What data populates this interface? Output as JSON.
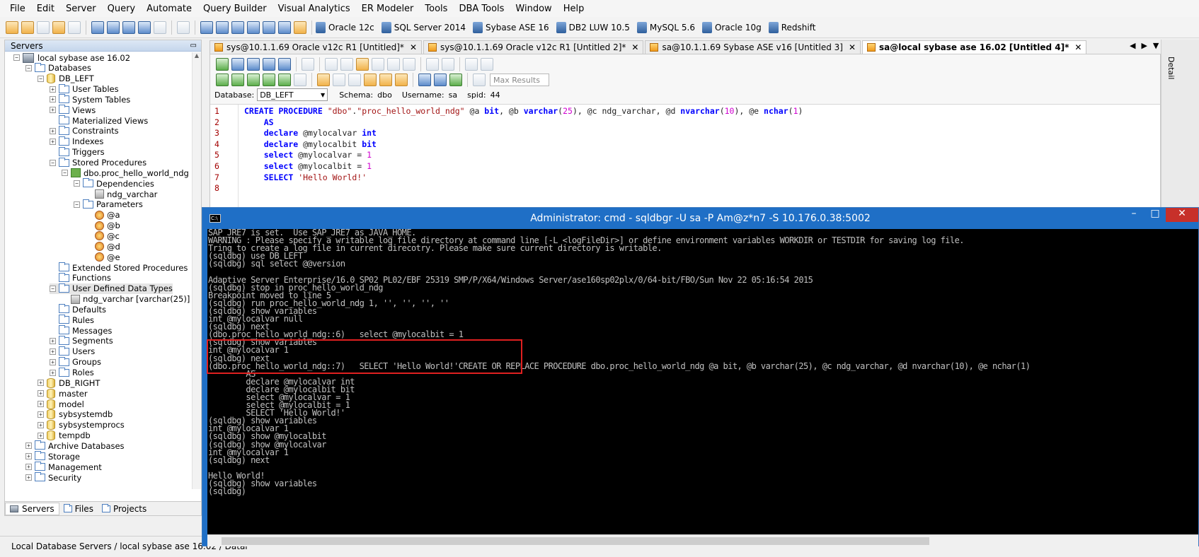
{
  "menu": [
    "File",
    "Edit",
    "Server",
    "Query",
    "Automate",
    "Query Builder",
    "Visual Analytics",
    "ER Modeler",
    "Tools",
    "DBA Tools",
    "Window",
    "Help"
  ],
  "toolbar": {
    "connections": [
      "Oracle 12c",
      "SQL Server 2014",
      "Sybase ASE 16",
      "DB2 LUW 10.5",
      "MySQL 5.6",
      "Oracle 10g",
      "Redshift"
    ]
  },
  "servers_panel": {
    "title": "Servers",
    "tree": [
      {
        "label": "local sybase ase 16.02",
        "depth": 1,
        "exp": "-",
        "icon": "server-icon"
      },
      {
        "label": "Databases",
        "depth": 2,
        "exp": "-",
        "icon": "folder-icon"
      },
      {
        "label": "DB_LEFT",
        "depth": 3,
        "exp": "-",
        "icon": "database-icon"
      },
      {
        "label": "User Tables",
        "depth": 4,
        "exp": "+",
        "icon": "folder-icon"
      },
      {
        "label": "System Tables",
        "depth": 4,
        "exp": "+",
        "icon": "folder-icon"
      },
      {
        "label": "Views",
        "depth": 4,
        "exp": "+",
        "icon": "folder-icon"
      },
      {
        "label": "Materialized Views",
        "depth": 4,
        "exp": "",
        "icon": "folder-icon"
      },
      {
        "label": "Constraints",
        "depth": 4,
        "exp": "+",
        "icon": "folder-icon"
      },
      {
        "label": "Indexes",
        "depth": 4,
        "exp": "+",
        "icon": "folder-icon"
      },
      {
        "label": "Triggers",
        "depth": 4,
        "exp": "",
        "icon": "folder-icon"
      },
      {
        "label": "Stored Procedures",
        "depth": 4,
        "exp": "-",
        "icon": "folder-icon"
      },
      {
        "label": "dbo.proc_hello_world_ndg",
        "depth": 5,
        "exp": "-",
        "icon": "stored-proc-icon"
      },
      {
        "label": "Dependencies",
        "depth": 6,
        "exp": "-",
        "icon": "folder-icon"
      },
      {
        "label": "ndg_varchar",
        "depth": 7,
        "exp": "",
        "icon": "grid-icon"
      },
      {
        "label": "Parameters",
        "depth": 6,
        "exp": "-",
        "icon": "folder-icon"
      },
      {
        "label": "@a",
        "depth": 7,
        "exp": "",
        "icon": "parameter-icon"
      },
      {
        "label": "@b",
        "depth": 7,
        "exp": "",
        "icon": "parameter-icon"
      },
      {
        "label": "@c",
        "depth": 7,
        "exp": "",
        "icon": "parameter-icon"
      },
      {
        "label": "@d",
        "depth": 7,
        "exp": "",
        "icon": "parameter-icon"
      },
      {
        "label": "@e",
        "depth": 7,
        "exp": "",
        "icon": "parameter-icon"
      },
      {
        "label": "Extended Stored Procedures",
        "depth": 4,
        "exp": "",
        "icon": "folder-icon"
      },
      {
        "label": "Functions",
        "depth": 4,
        "exp": "",
        "icon": "folder-icon"
      },
      {
        "label": "User Defined Data Types",
        "depth": 4,
        "exp": "-",
        "icon": "folder-icon",
        "selected": true
      },
      {
        "label": "ndg_varchar [varchar(25)]",
        "depth": 5,
        "exp": "",
        "icon": "grid-icon"
      },
      {
        "label": "Defaults",
        "depth": 4,
        "exp": "",
        "icon": "folder-icon"
      },
      {
        "label": "Rules",
        "depth": 4,
        "exp": "",
        "icon": "folder-icon"
      },
      {
        "label": "Messages",
        "depth": 4,
        "exp": "",
        "icon": "folder-icon"
      },
      {
        "label": "Segments",
        "depth": 4,
        "exp": "+",
        "icon": "folder-icon"
      },
      {
        "label": "Users",
        "depth": 4,
        "exp": "+",
        "icon": "folder-icon"
      },
      {
        "label": "Groups",
        "depth": 4,
        "exp": "+",
        "icon": "folder-icon"
      },
      {
        "label": "Roles",
        "depth": 4,
        "exp": "+",
        "icon": "folder-icon"
      },
      {
        "label": "DB_RIGHT",
        "depth": 3,
        "exp": "+",
        "icon": "database-icon"
      },
      {
        "label": "master",
        "depth": 3,
        "exp": "+",
        "icon": "database-icon"
      },
      {
        "label": "model",
        "depth": 3,
        "exp": "+",
        "icon": "database-icon"
      },
      {
        "label": "sybsystemdb",
        "depth": 3,
        "exp": "+",
        "icon": "database-icon"
      },
      {
        "label": "sybsystemprocs",
        "depth": 3,
        "exp": "+",
        "icon": "database-icon"
      },
      {
        "label": "tempdb",
        "depth": 3,
        "exp": "+",
        "icon": "database-icon"
      },
      {
        "label": "Archive Databases",
        "depth": 2,
        "exp": "+",
        "icon": "folder-icon"
      },
      {
        "label": "Storage",
        "depth": 2,
        "exp": "+",
        "icon": "folder-icon"
      },
      {
        "label": "Management",
        "depth": 2,
        "exp": "+",
        "icon": "folder-icon"
      },
      {
        "label": "Security",
        "depth": 2,
        "exp": "+",
        "icon": "folder-icon"
      }
    ],
    "bottom_tabs": [
      "Servers",
      "Files",
      "Projects"
    ]
  },
  "status": "Local Database Servers / local sybase ase 16.02 / Datal",
  "editor": {
    "tabs": [
      {
        "label": "sys@10.1.1.69 Oracle  v12c R1 [Untitled]*",
        "active": false
      },
      {
        "label": "sys@10.1.1.69 Oracle  v12c R1 [Untitled 2]*",
        "active": false
      },
      {
        "label": "sa@10.1.1.69 Sybase ASE v16 [Untitled 3]",
        "active": false
      },
      {
        "label": "sa@local sybase ase 16.02 [Untitled 4]*",
        "active": true
      }
    ],
    "max_results_placeholder": "Max Results",
    "database_label": "Database:",
    "database_value": "DB_LEFT",
    "schema_label": "Schema:",
    "schema_value": "dbo",
    "username_label": "Username:",
    "username_value": "sa",
    "spid_label": "spid:",
    "spid_value": "44",
    "line_numbers": [
      "1",
      "2",
      "3",
      "4",
      "5",
      "6",
      "7",
      "8"
    ],
    "detail_label": "Detail"
  },
  "cmd": {
    "title": "Administrator: cmd - sqldbgr  -U sa -P Am@z*n7 -S 10.176.0.38:5002",
    "icon_text": "C:\\",
    "lines": [
      "SAP_JRE7 is set.  Use SAP_JRE7 as JAVA_HOME.",
      "WARNING : Please specify a writable log file directory at command line [-L <logFileDir>] or define environment variables WORKDIR or TESTDIR for saving log file.",
      "Tring to create a log file in current direcotry. Please make sure current directory is writable.",
      "(sqldbg) use DB_LEFT",
      "(sqldbg) sql select @@version",
      "",
      "Adaptive Server Enterprise/16.0 SP02 PL02/EBF 25319 SMP/P/X64/Windows Server/ase160sp02plx/0/64-bit/FBO/Sun Nov 22 05:16:54 2015",
      "(sqldbg) stop in proc_hello_world_ndg",
      "Breakpoint moved to line 5",
      "(sqldbg) run proc_hello_world_ndg 1, '', '', '', ''",
      "(sqldbg) show variables",
      "int @mylocalvar null",
      "(sqldbg) next",
      "(dbo.proc_hello_world_ndg::6)   select @mylocalbit = 1",
      "(sqldbg) show variables",
      "int @mylocalvar 1",
      "(sqldbg) next",
      "(dbo.proc_hello_world_ndg::7)   SELECT 'Hello World!'CREATE OR REPLACE PROCEDURE dbo.proc_hello_world_ndg @a bit, @b varchar(25), @c ndg_varchar, @d nvarchar(10), @e nchar(1)",
      "        AS",
      "        declare @mylocalvar int",
      "        declare @mylocalbit bit",
      "        select @mylocalvar = 1",
      "        select @mylocalbit = 1",
      "        SELECT 'Hello World!'",
      "(sqldbg) show variables",
      "int @mylocalvar 1",
      "(sqldbg) show @mylocalbit",
      "(sqldbg) show @mylocalvar",
      "int @mylocalvar 1",
      "(sqldbg) next",
      "",
      "Hello World!",
      "(sqldbg) show variables",
      "(sqldbg)"
    ]
  },
  "code": [
    [
      [
        "kw",
        "CREATE PROCEDURE "
      ],
      [
        "st",
        "\"dbo\""
      ],
      [
        "pl",
        "."
      ],
      [
        "st",
        "\"proc_hello_world_ndg\""
      ],
      [
        "pl",
        " @a "
      ],
      [
        "kw",
        "bit"
      ],
      [
        "pl",
        ", @b "
      ],
      [
        "kw",
        "varchar"
      ],
      [
        "pl",
        "("
      ],
      [
        "num",
        "25"
      ],
      [
        "pl",
        "), @c ndg_varchar, @d "
      ],
      [
        "kw",
        "nvarchar"
      ],
      [
        "pl",
        "("
      ],
      [
        "num",
        "10"
      ],
      [
        "pl",
        "), @e "
      ],
      [
        "kw",
        "nchar"
      ],
      [
        "pl",
        "("
      ],
      [
        "num",
        "1"
      ],
      [
        "pl",
        ")"
      ]
    ],
    [
      [
        "pl",
        "    "
      ],
      [
        "kw",
        "AS"
      ]
    ],
    [
      [
        "pl",
        "    "
      ],
      [
        "kw",
        "declare"
      ],
      [
        "pl",
        " @mylocalvar "
      ],
      [
        "kw",
        "int"
      ]
    ],
    [
      [
        "pl",
        "    "
      ],
      [
        "kw",
        "declare"
      ],
      [
        "pl",
        " @mylocalbit "
      ],
      [
        "kw",
        "bit"
      ]
    ],
    [
      [
        "pl",
        "    "
      ],
      [
        "kw",
        "select"
      ],
      [
        "pl",
        " @mylocalvar = "
      ],
      [
        "num",
        "1"
      ]
    ],
    [
      [
        "pl",
        "    "
      ],
      [
        "kw",
        "select"
      ],
      [
        "pl",
        " @mylocalbit = "
      ],
      [
        "num",
        "1"
      ]
    ],
    [
      [
        "pl",
        "    "
      ],
      [
        "kw",
        "SELECT"
      ],
      [
        "pl",
        " "
      ],
      [
        "st",
        "'Hello World!'"
      ]
    ],
    []
  ]
}
